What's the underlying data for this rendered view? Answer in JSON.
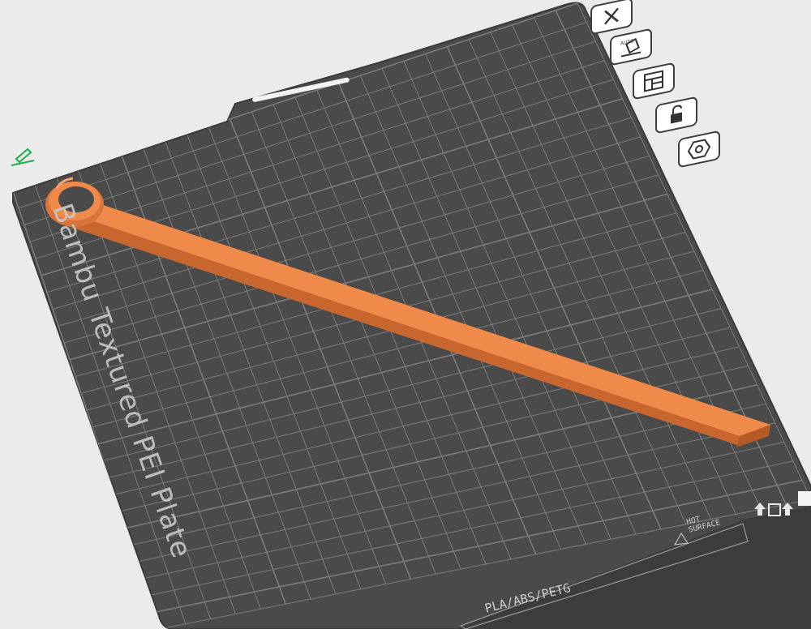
{
  "plate": {
    "name": "Bambu Textured PEI Plate",
    "material_label": "PLA/ABS/PETG",
    "hot_surface_line1": "HOT",
    "hot_surface_line2": "SURFACE"
  },
  "toolbar": {
    "buttons": [
      {
        "name": "close-button",
        "icon": "x-icon"
      },
      {
        "name": "auto-orient-button",
        "icon": "auto-orient-icon",
        "label": "AUTO"
      },
      {
        "name": "arrange-button",
        "icon": "arrange-icon"
      },
      {
        "name": "lock-button",
        "icon": "unlock-icon"
      },
      {
        "name": "plate-settings-button",
        "icon": "hexagon-settings-icon"
      }
    ]
  },
  "colors": {
    "background": "#ebebeb",
    "plate": "#4a4a4a",
    "grid": "#8a8a8a",
    "model": "#f08a4b",
    "edit_icon": "#1fae4a"
  }
}
